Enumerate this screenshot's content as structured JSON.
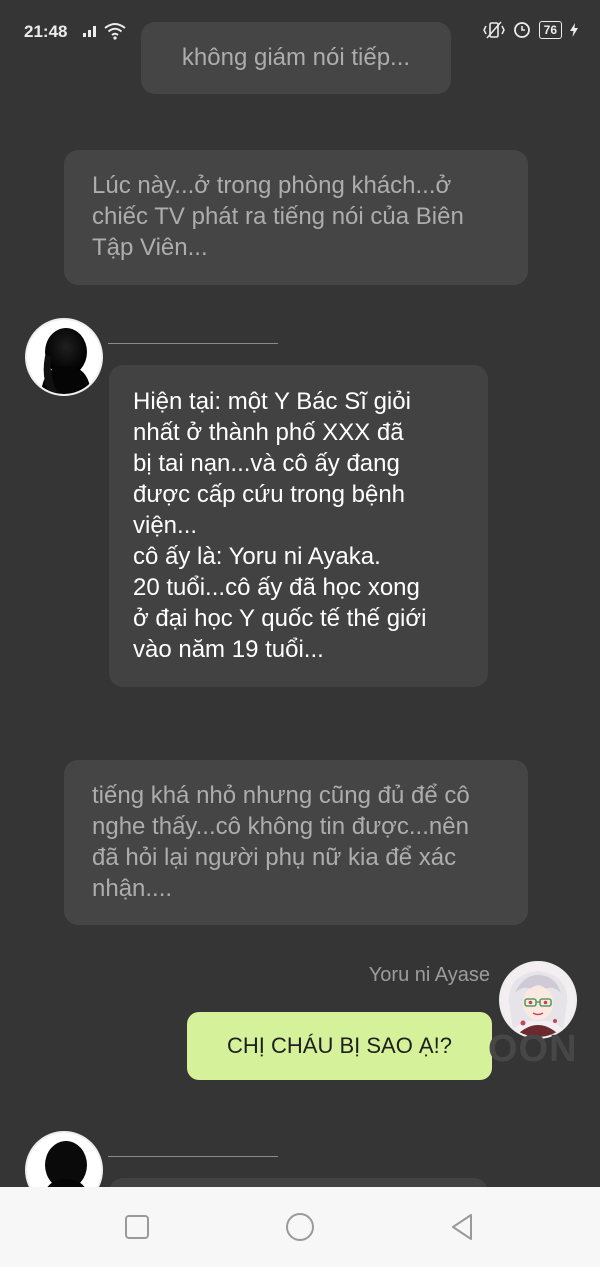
{
  "status_bar": {
    "time": "21:48",
    "battery": "76",
    "icons": [
      "signal-icon",
      "wifi-icon",
      "vibrate-icon",
      "alarm-icon",
      "battery-icon",
      "charging-icon"
    ]
  },
  "messages": {
    "narration_1": "không giám nói tiếp...",
    "narration_2": "Lúc này...ở trong phòng khách...ở chiếc TV phát ra tiếng nói của Biên Tập Viên...",
    "speech_1_lines": [
      "Hiện tại: một Y Bác Sĩ giỏi",
      "nhất ở thành phố XXX đã",
      "bị tai nạn...và cô ấy đang",
      "được cấp cứu trong bệnh",
      "viện...",
      "cô ấy là: Yoru ni Ayaka.",
      "20 tuổi...cô ấy đã học xong",
      "ở đại học Y quốc tế thế giới",
      "vào năm 19 tuổi..."
    ],
    "narration_3": "tiếng khá nhỏ nhưng cũng đủ để cô nghe thấy...cô không tin được...nên đã hỏi lại người phụ nữ kia để xác nhận....",
    "user_name": "Yoru ni Ayase",
    "user_message": "CHỊ CHÁU BỊ SAO Ạ!?"
  },
  "watermark": "OON",
  "colors": {
    "background": "#353535",
    "narration_bubble": "#454545",
    "speech_bubble": "#424242",
    "user_bubble": "#d5f29a",
    "nav_bar": "#f7f7f7"
  }
}
